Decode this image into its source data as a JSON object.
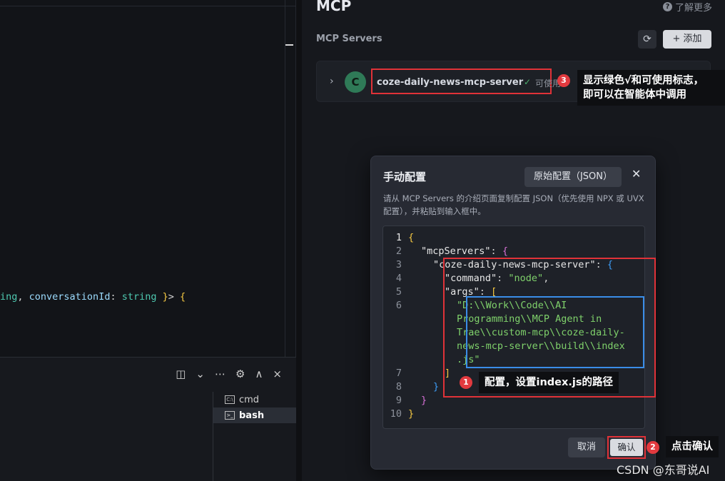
{
  "editor": {
    "code_tokens": [
      {
        "text": "ing",
        "cls": "t-type"
      },
      {
        "text": ", ",
        "cls": "t-plain"
      },
      {
        "text": "conversationId",
        "cls": "t-kw"
      },
      {
        "text": ": ",
        "cls": "t-plain"
      },
      {
        "text": "string",
        "cls": "t-type"
      },
      {
        "text": " }",
        "cls": "t-brace"
      },
      {
        "text": "> ",
        "cls": "t-plain"
      },
      {
        "text": "{",
        "cls": "t-brace"
      }
    ]
  },
  "terminal": {
    "toolbar": {
      "split": "◫",
      "chevron": "⌄",
      "more": "⋯",
      "settings": "⚙",
      "collapse": "∧",
      "close": "×"
    },
    "items": [
      {
        "label": "cmd",
        "icon": "C:\\",
        "active": false
      },
      {
        "label": "bash",
        "icon": ">_",
        "active": true
      }
    ]
  },
  "mcp": {
    "title": "MCP",
    "learn_more": "了解更多",
    "servers_label": "MCP Servers",
    "refresh_icon": "⟳",
    "add_label": "+ 添加",
    "server": {
      "avatar": "C",
      "name": "coze-daily-news-mcp-server",
      "status_check": "✓",
      "status": "可使用"
    }
  },
  "annotations": {
    "badge1": "1",
    "badge2": "2",
    "badge3": "3",
    "callout3_line1": "显示绿色√和可使用标志，",
    "callout3_line2": "即可以在智能体中调用",
    "callout1": "配置，设置index.js的路径",
    "callout2": "点击确认"
  },
  "dialog": {
    "title": "手动配置",
    "raw_button": "原始配置（JSON）",
    "close": "✕",
    "description": "请从 MCP Servers 的介绍页面复制配置 JSON（优先使用 NPX 或 UVX 配置），并粘贴到输入框中。",
    "cancel": "取消",
    "confirm": "确认",
    "line_numbers": [
      "1",
      "2",
      "3",
      "4",
      "5",
      "6",
      "7",
      "8",
      "9",
      "10"
    ],
    "code": {
      "l1": "{",
      "l2_key": "\"mcpServers\"",
      "l2_rest": ": ",
      "l2_brace": "{",
      "l3_key": "\"coze-daily-news-mcp-server\"",
      "l3_rest": ": ",
      "l3_brace": "{",
      "l4_key": "\"command\"",
      "l4_rest": ": ",
      "l4_val": "\"node\"",
      "l4_end": ",",
      "l5_key": "\"args\"",
      "l5_rest": ": ",
      "l5_brace": "[",
      "l6_a": "\"D:\\\\Work\\\\Code\\\\AI",
      "l6_b": "Programming\\\\MCP Agent in",
      "l6_c": "Trae\\\\custom-mcp\\\\coze-daily-",
      "l6_d": "news-mcp-server\\\\build\\\\index",
      "l6_e": ".js\"",
      "l7": "]",
      "l8": "}",
      "l9": "}",
      "l10": "}"
    }
  },
  "watermark": "CSDN @东哥说AI"
}
